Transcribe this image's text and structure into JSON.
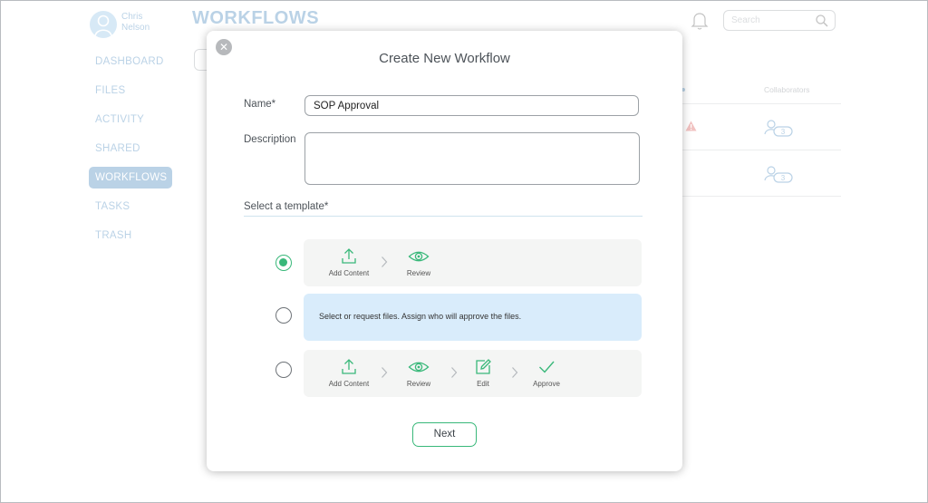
{
  "user": {
    "first_name": "Chris",
    "last_name": "Nelson"
  },
  "app": {
    "page_title": "WORKFLOWS",
    "search_placeholder": "Search"
  },
  "nav": {
    "items": [
      {
        "label": "DASHBOARD",
        "active": false
      },
      {
        "label": "FILES",
        "active": false
      },
      {
        "label": "ACTIVITY",
        "active": false
      },
      {
        "label": "SHARED",
        "active": false
      },
      {
        "label": "WORKFLOWS",
        "active": true
      },
      {
        "label": "TASKS",
        "active": false
      },
      {
        "label": "TRASH",
        "active": false
      }
    ]
  },
  "table": {
    "collaborators_header": "Collaborators",
    "rows": [
      {
        "collaborators": "3",
        "warning": true
      },
      {
        "collaborators": "3",
        "warning": false
      }
    ]
  },
  "modal": {
    "title": "Create New Workflow",
    "name_label": "Name*",
    "name_value": "SOP Approval",
    "description_label": "Description",
    "description_value": "",
    "template_label": "Select a template*",
    "templates": [
      {
        "selected": true,
        "steps": [
          {
            "label": "Add Content",
            "icon": "upload-icon"
          },
          {
            "label": "Review",
            "icon": "eye-icon"
          }
        ]
      },
      {
        "selected": false,
        "description": "Select or request files.  Assign who will approve the files."
      },
      {
        "selected": false,
        "steps": [
          {
            "label": "Add Content",
            "icon": "upload-icon"
          },
          {
            "label": "Review",
            "icon": "eye-icon"
          },
          {
            "label": "Edit",
            "icon": "edit-icon"
          },
          {
            "label": "Approve",
            "icon": "check-icon"
          }
        ]
      }
    ],
    "next_label": "Next"
  },
  "colors": {
    "accent_green": "#39b87a",
    "brand_blue": "#3b7fb9",
    "selected_card": "#d9ecfb",
    "warning_red": "#d9534f"
  }
}
